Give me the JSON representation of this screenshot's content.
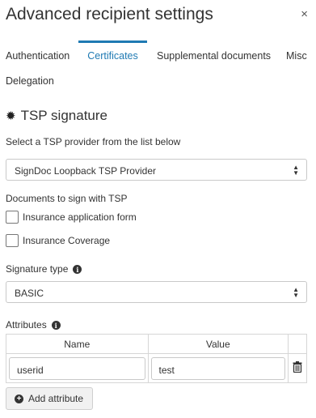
{
  "dialog": {
    "title": "Advanced recipient settings",
    "close_label": "×"
  },
  "tabs": [
    {
      "label": "Authentication"
    },
    {
      "label": "Certificates",
      "active": true
    },
    {
      "label": "Supplemental documents"
    },
    {
      "label": "Misc"
    },
    {
      "label": "Delegation"
    }
  ],
  "tsp": {
    "section_title": "TSP signature",
    "provider_label": "Select a TSP provider from the list below",
    "provider_value": "SignDoc Loopback TSP Provider",
    "documents_label": "Documents to sign with TSP",
    "documents": [
      {
        "label": "Insurance application form",
        "checked": false
      },
      {
        "label": "Insurance Coverage",
        "checked": false
      }
    ],
    "signature_type_label": "Signature type",
    "signature_type_value": "BASIC"
  },
  "attributes": {
    "label": "Attributes",
    "columns": [
      "Name",
      "Value"
    ],
    "rows": [
      {
        "name": "userid",
        "value": "test"
      }
    ],
    "add_label": "Add attribute"
  },
  "colors": {
    "accent": "#1f7ab3",
    "text": "#333333",
    "border": "#c9c9c9"
  }
}
